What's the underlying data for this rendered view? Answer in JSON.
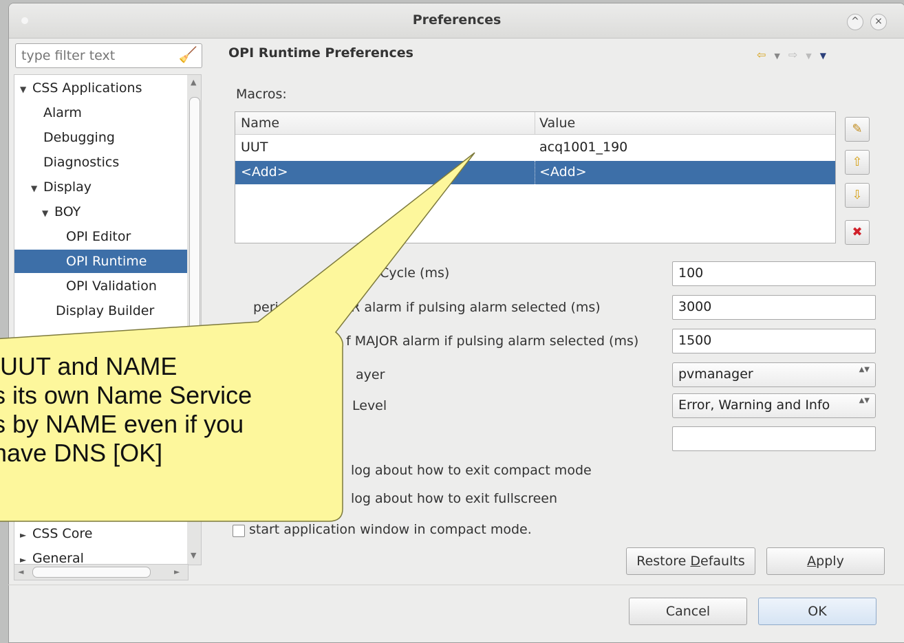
{
  "window": {
    "title": "Preferences",
    "min_glyph": "^",
    "close_glyph": "×"
  },
  "filter": {
    "placeholder": "type filter text"
  },
  "tree": {
    "items": [
      {
        "label": "CSS Applications",
        "twisty": "▼"
      },
      {
        "label": "Alarm"
      },
      {
        "label": "Debugging"
      },
      {
        "label": "Diagnostics"
      },
      {
        "label": "Display",
        "twisty": "▼"
      },
      {
        "label": "BOY",
        "twisty": "▼"
      },
      {
        "label": "OPI Editor"
      },
      {
        "label": "OPI Runtime"
      },
      {
        "label": "OPI Validation"
      },
      {
        "label": "Display Builder"
      },
      {
        "label": "CSS Core",
        "twisty": "►"
      },
      {
        "label": "General",
        "twisty": "►"
      }
    ]
  },
  "page": {
    "title": "OPI Runtime Preferences",
    "macros_label": "Macros:"
  },
  "nav": {
    "back": "⇦",
    "back_menu": "▼",
    "fwd": "⇨",
    "fwd_menu": "▼",
    "view_menu": "▼"
  },
  "macros_table": {
    "columns": [
      "Name",
      "Value"
    ],
    "rows": [
      {
        "name": "UUT",
        "value": "acq1001_190"
      },
      {
        "name": "<Add>",
        "value": "<Add>"
      }
    ]
  },
  "side_buttons": {
    "edit": "✎",
    "up": "⇧",
    "down": "⇩",
    "delete": "✖"
  },
  "settings": {
    "refresh_label": "resh Cycle (ms)",
    "refresh_value": "100",
    "minor_label": "period of MINOR alarm if pulsing alarm selected (ms)",
    "minor_value": "3000",
    "major_label": "f MAJOR alarm if pulsing alarm selected (ms)",
    "major_value": "1500",
    "layer_label": "ayer",
    "layer_value": "pvmanager",
    "level_label": "Level",
    "level_value": "Error, Warning and Info",
    "updown": "▲▼",
    "empty_value": "",
    "compact_dialog_label": "log about how to exit compact mode",
    "fullscreen_dialog_label": "log about how to exit fullscreen",
    "start_compact_label": "start application window in compact mode."
  },
  "buttons": {
    "restore_pre": "Restore ",
    "restore_u": "D",
    "restore_post": "efaults",
    "apply_u": "A",
    "apply_post": "pply",
    "cancel": "Cancel",
    "ok": "OK"
  },
  "callout": {
    "lines": [
      "UUT and NAME",
      "s its own Name Service",
      "s by NAME even if you",
      "have DNS  [OK]"
    ],
    "fill": "#fdf79c"
  }
}
